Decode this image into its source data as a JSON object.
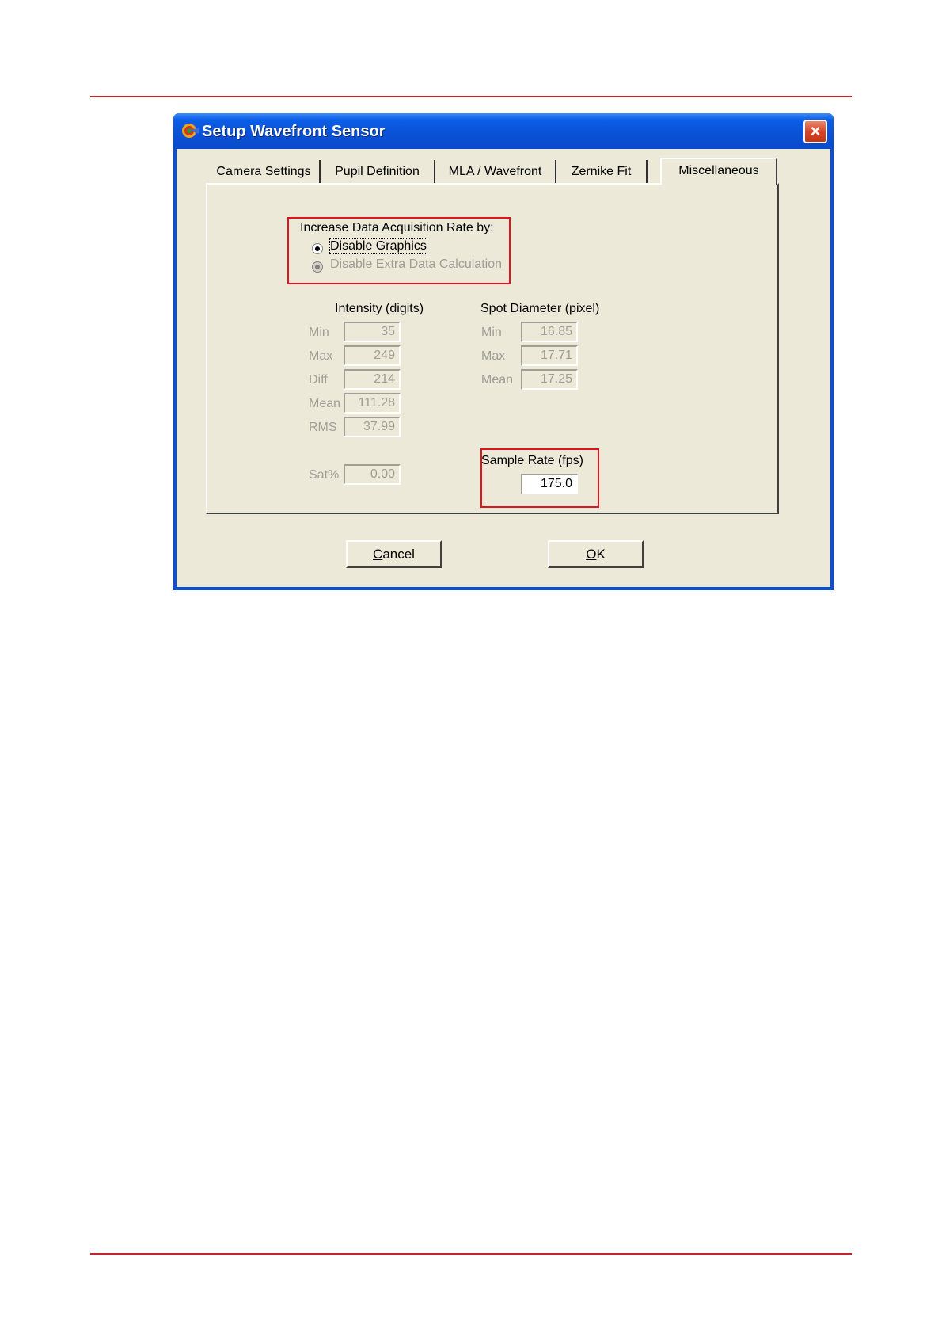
{
  "window": {
    "title": "Setup Wavefront Sensor",
    "close_label": "×"
  },
  "tabs": [
    {
      "label": "Camera Settings",
      "active": false
    },
    {
      "label": "Pupil Definition",
      "active": false
    },
    {
      "label": "MLA / Wavefront",
      "active": false
    },
    {
      "label": "Zernike Fit",
      "active": false
    },
    {
      "label": "Miscellaneous",
      "active": true
    }
  ],
  "acquisition": {
    "heading": "Increase Data Acquisition Rate by:",
    "options": [
      {
        "label": "Disable Graphics",
        "selected": true,
        "enabled": true
      },
      {
        "label": "Disable Extra Data Calculation",
        "selected": true,
        "enabled": false
      }
    ]
  },
  "intensity": {
    "heading": "Intensity (digits)",
    "rows": [
      {
        "label": "Min",
        "value": "35"
      },
      {
        "label": "Max",
        "value": "249"
      },
      {
        "label": "Diff",
        "value": "214"
      },
      {
        "label": "Mean",
        "value": "111.28"
      },
      {
        "label": "RMS",
        "value": "37.99"
      }
    ],
    "sat": {
      "label": "Sat%",
      "value": "0.00"
    }
  },
  "spot_diameter": {
    "heading": "Spot Diameter (pixel)",
    "rows": [
      {
        "label": "Min",
        "value": "16.85"
      },
      {
        "label": "Max",
        "value": "17.71"
      },
      {
        "label": "Mean",
        "value": "17.25"
      }
    ]
  },
  "sample_rate": {
    "label": "Sample Rate (fps)",
    "value": "175.0"
  },
  "buttons": {
    "cancel_prefix": "C",
    "cancel_rest": "ancel",
    "ok_prefix": "O",
    "ok_rest": "K"
  },
  "colors": {
    "accent_rule": "#c4242b",
    "highlight_box": "#e1141d",
    "titlebar": "#0a52d8",
    "dialog_bg": "#ece9d8"
  }
}
